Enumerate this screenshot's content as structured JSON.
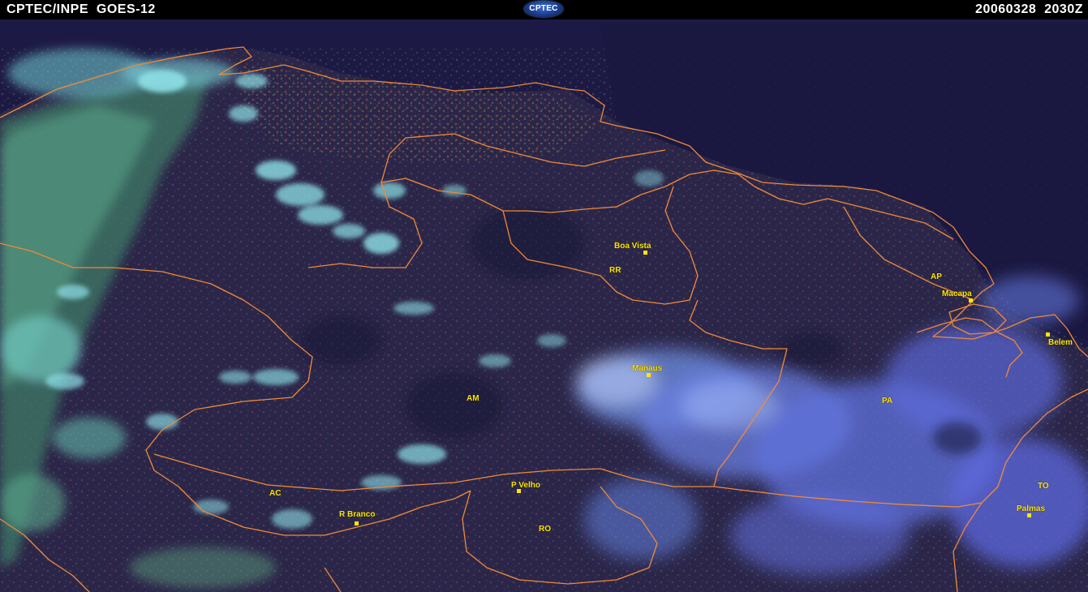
{
  "header": {
    "left_title": "CPTEC/INPE  GOES-12",
    "logo_text": "CPTEC",
    "timestamp": "20060328  2030Z"
  },
  "colors": {
    "background": "#000000",
    "header_text": "#ffffff",
    "label": "#ffe600",
    "borders": "#f08a3a",
    "ocean": "#1c1a44",
    "land": "#2a2848"
  },
  "map": {
    "cities": [
      "Boa Vista",
      "Macapa",
      "Belem",
      "Manaus",
      "P Velho",
      "R Branco",
      "Palmas"
    ],
    "states": [
      "RR",
      "AP",
      "AM",
      "PA",
      "AC",
      "RO",
      "TO"
    ]
  }
}
